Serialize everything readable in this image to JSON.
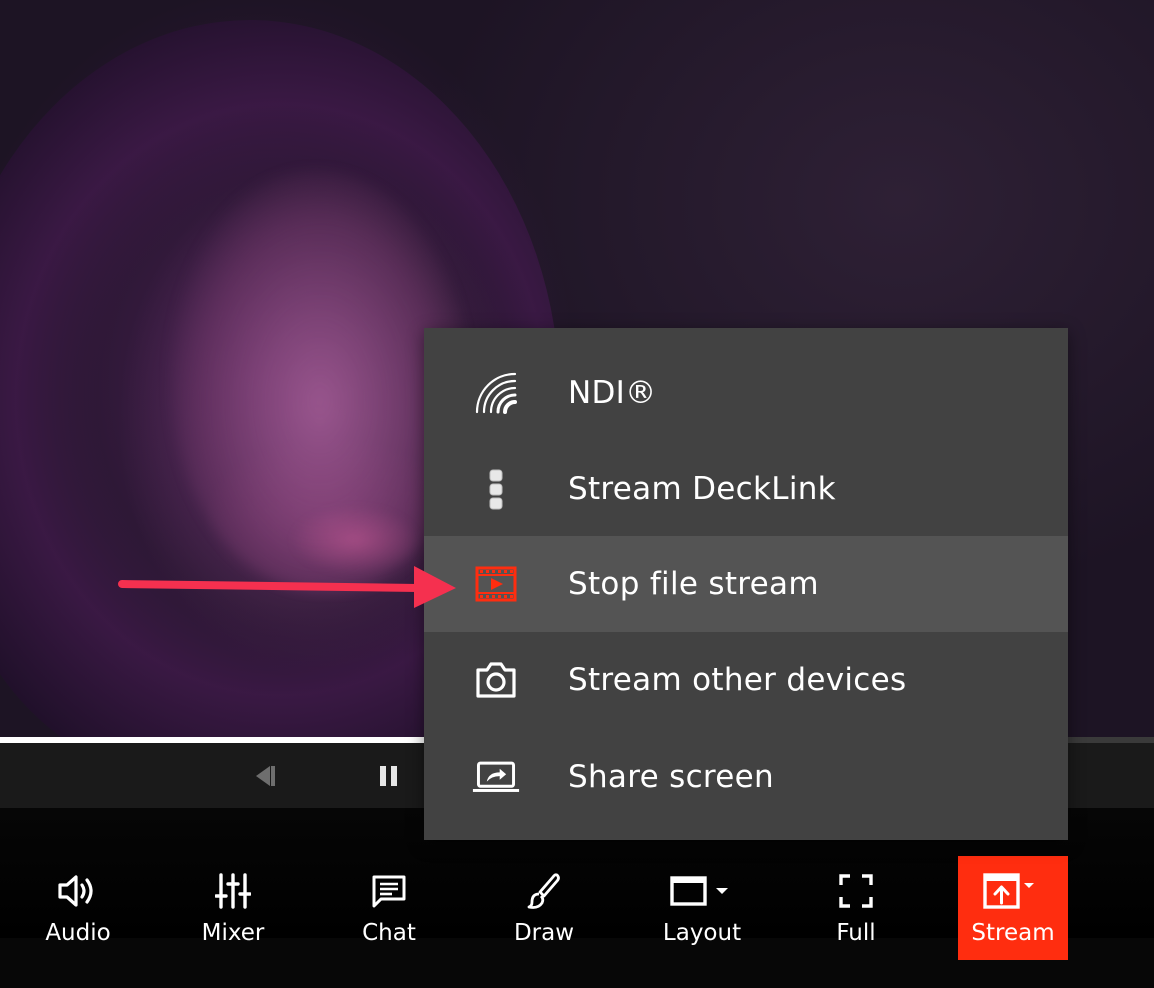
{
  "player": {
    "progress_percent": 37
  },
  "menu": {
    "items": [
      {
        "label": "NDI®",
        "icon": "ndi-signal-icon"
      },
      {
        "label": "Stream DeckLink",
        "icon": "decklink-icon"
      },
      {
        "label": "Stop file stream",
        "icon": "film-play-icon",
        "highlighted": true
      },
      {
        "label": "Stream other devices",
        "icon": "camera-icon"
      },
      {
        "label": "Share screen",
        "icon": "share-screen-icon"
      }
    ]
  },
  "toolbar": {
    "items": [
      {
        "label": "Audio",
        "icon": "speaker-icon"
      },
      {
        "label": "Mixer",
        "icon": "mixer-sliders-icon"
      },
      {
        "label": "Chat",
        "icon": "chat-icon"
      },
      {
        "label": "Draw",
        "icon": "brush-icon"
      },
      {
        "label": "Layout",
        "icon": "layout-window-icon"
      },
      {
        "label": "Full",
        "icon": "fullscreen-icon"
      },
      {
        "label": "Stream",
        "icon": "stream-upload-icon",
        "active": true
      }
    ]
  },
  "colors": {
    "accent": "#ff2d0f",
    "annotation_arrow": "#f5304f",
    "menu_bg": "#424242",
    "menu_highlight": "#545454"
  }
}
